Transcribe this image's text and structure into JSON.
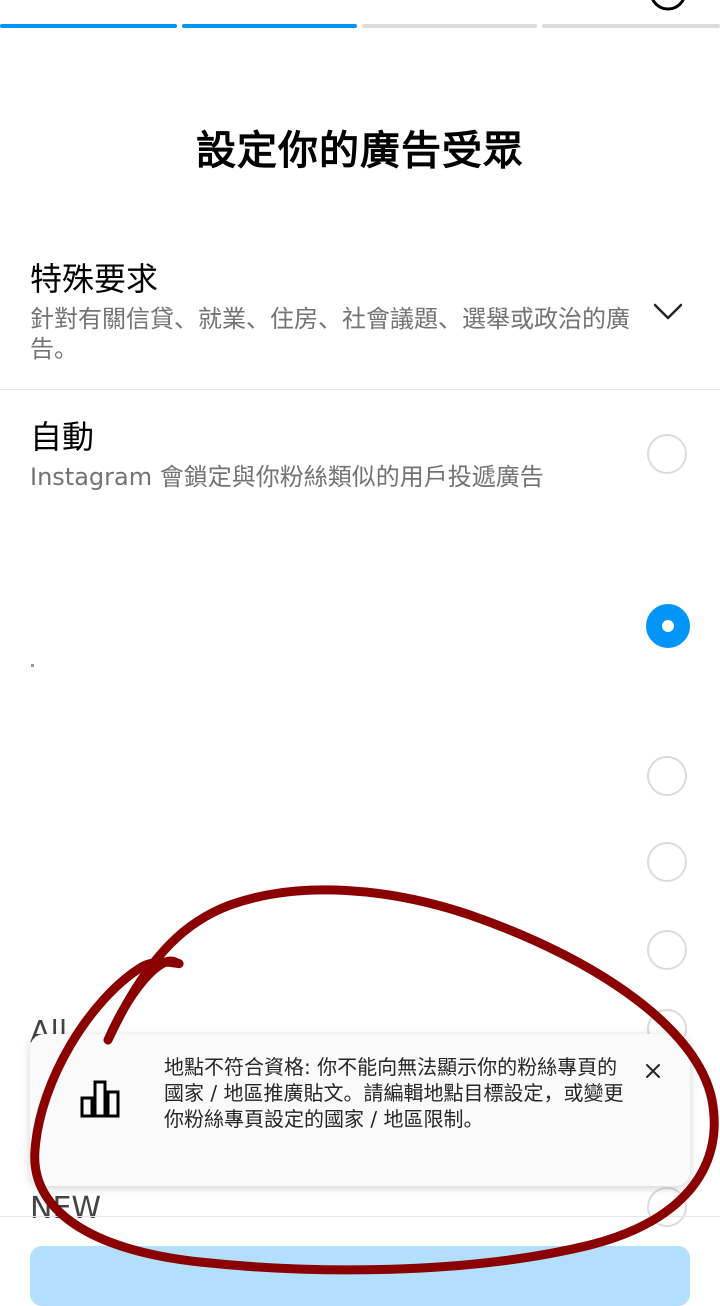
{
  "header": {
    "title_partial": "...",
    "progress": {
      "completed_steps": 2,
      "total_steps": 4
    },
    "back_icon": "chevron-left-icon",
    "help_icon": "help-circle-icon"
  },
  "page_title": "設定你的廣告受眾",
  "special_requirements": {
    "title": "特殊要求",
    "description": "針對有關信貸、就業、住房、社會議題、選舉或政治的廣告。",
    "icon": "chevron-down-icon"
  },
  "audience_options": [
    {
      "title": "自動",
      "description": "Instagram 會鎖定與你粉絲類似的用戶投遞廣告",
      "selected": false
    },
    {
      "title": "",
      "description": "",
      "selected": true
    },
    {
      "title": "",
      "description": "",
      "selected": false
    },
    {
      "title": "",
      "description": "",
      "selected": false
    },
    {
      "title": "",
      "description": "",
      "selected": false
    },
    {
      "title": "All",
      "description": "",
      "selected": false
    },
    {
      "title": "NEW",
      "description": "",
      "selected": false
    }
  ],
  "toast": {
    "message": "地點不符合資格: 你不能向無法顯示你的粉絲專頁的國家 / 地區推廣貼文。請編輯地點目標設定，或變更你粉絲專頁設定的國家 / 地區限制。",
    "icon": "bar-chart-icon",
    "close_icon": "close-icon"
  },
  "colors": {
    "accent": "#0095f6",
    "progress_done": "#0095f6",
    "progress_todo": "#dbdbdb",
    "annotation": "#8b0000"
  }
}
